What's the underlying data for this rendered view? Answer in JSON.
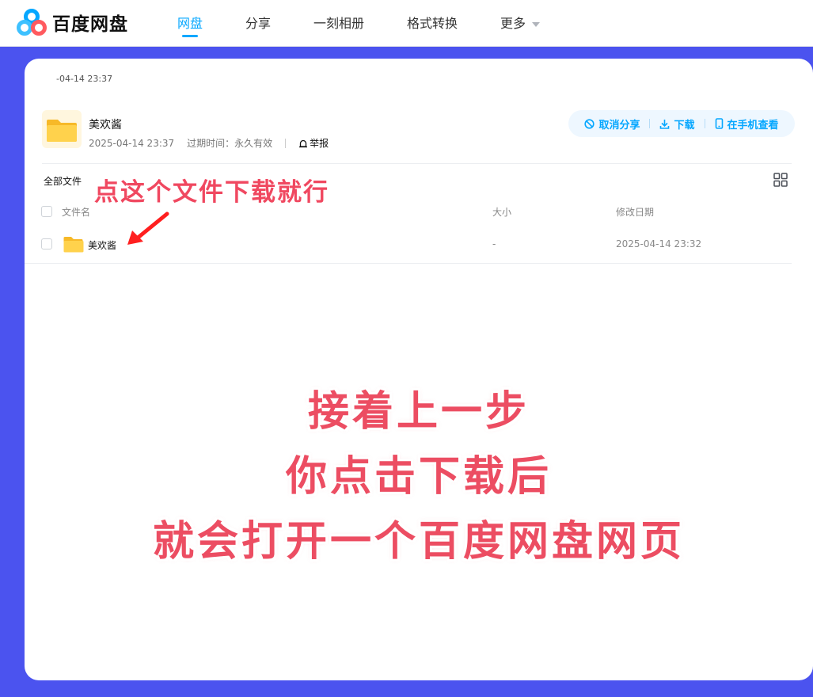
{
  "brand": {
    "name": "百度网盘",
    "colors": {
      "primary": "#06a7ff",
      "background": "#4b53ef",
      "annotation": "#ec4d62"
    }
  },
  "nav": {
    "items": [
      {
        "label": "网盘",
        "active": true
      },
      {
        "label": "分享",
        "active": false
      },
      {
        "label": "一刻相册",
        "active": false
      },
      {
        "label": "格式转换",
        "active": false
      },
      {
        "label": "更多",
        "active": false
      }
    ]
  },
  "share": {
    "top_time": "-04-14 23:37",
    "name": "美欢酱",
    "created": "2025-04-14 23:37",
    "expiry": "过期时间：永久有效",
    "report": "举报",
    "actions": {
      "cancel": "取消分享",
      "download": "下载",
      "mobile": "在手机查看"
    }
  },
  "files": {
    "breadcrumb": "全部文件",
    "columns": {
      "name": "文件名",
      "size": "大小",
      "modified": "修改日期"
    },
    "rows": [
      {
        "name": "美欢酱",
        "size": "-",
        "modified": "2025-04-14 23:32",
        "icon": "folder-icon"
      }
    ]
  },
  "annotations": {
    "hint": "点这个文件下载就行",
    "line1": "接着上一步",
    "line2": "你点击下载后",
    "line3": "就会打开一个百度网盘网页"
  }
}
